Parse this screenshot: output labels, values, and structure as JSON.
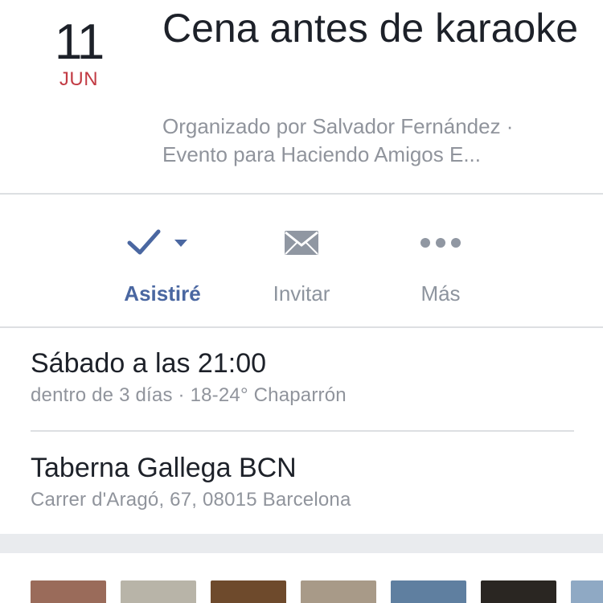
{
  "event": {
    "date_day": "11",
    "date_month": "JUN",
    "title": "Cena antes de karaoke",
    "subtitle": "Organizado por Salvador Fernández · Evento para Haciendo Amigos E..."
  },
  "actions": {
    "going": {
      "label": "Asistiré",
      "icon": "check-icon"
    },
    "invite": {
      "label": "Invitar",
      "icon": "envelope-icon"
    },
    "more": {
      "label": "Más",
      "icon": "more-dots-icon"
    }
  },
  "when": {
    "title": "Sábado a las 21:00",
    "detail": "dentro de 3 días · 18-24° Chaparrón"
  },
  "where": {
    "title": "Taberna Gallega BCN",
    "address": "Carrer d'Aragó, 67, 08015 Barcelona"
  },
  "colors": {
    "accent": "#4a67a1",
    "month": "#c23b44",
    "secondary_text": "#90949c",
    "divider": "#dddfe2",
    "band": "#e9ebee"
  },
  "photos": [
    {
      "color": "#9a6b5a"
    },
    {
      "color": "#b8b4a8"
    },
    {
      "color": "#6e4a2c"
    },
    {
      "color": "#a89a88"
    },
    {
      "color": "#5f7fa0"
    },
    {
      "color": "#2a2622"
    },
    {
      "color": "#8fa9c4"
    }
  ]
}
